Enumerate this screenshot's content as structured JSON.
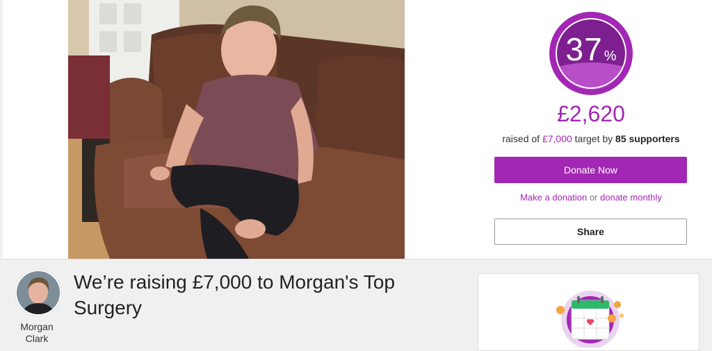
{
  "campaign": {
    "progress_percent": 37,
    "percent_number": "37",
    "percent_symbol": "%",
    "raised_amount": "£2,620",
    "raised_prefix": "raised of",
    "target_amount": "£7,000",
    "target_mid": "target by",
    "supporters_count": "85",
    "supporters_label": "supporters"
  },
  "actions": {
    "donate_now_label": "Donate Now",
    "make_donation_link": "Make a donation",
    "or_text": "or",
    "donate_monthly_link": "donate monthly",
    "share_label": "Share"
  },
  "page": {
    "title": "We’re raising £7,000 to Morgan's Top Surgery",
    "author_name_line1": "Morgan",
    "author_name_line2": "Clark"
  },
  "colors": {
    "accent": "#a227b4",
    "ring_dark": "#7e1f90",
    "ring_light": "#b84fc9"
  }
}
